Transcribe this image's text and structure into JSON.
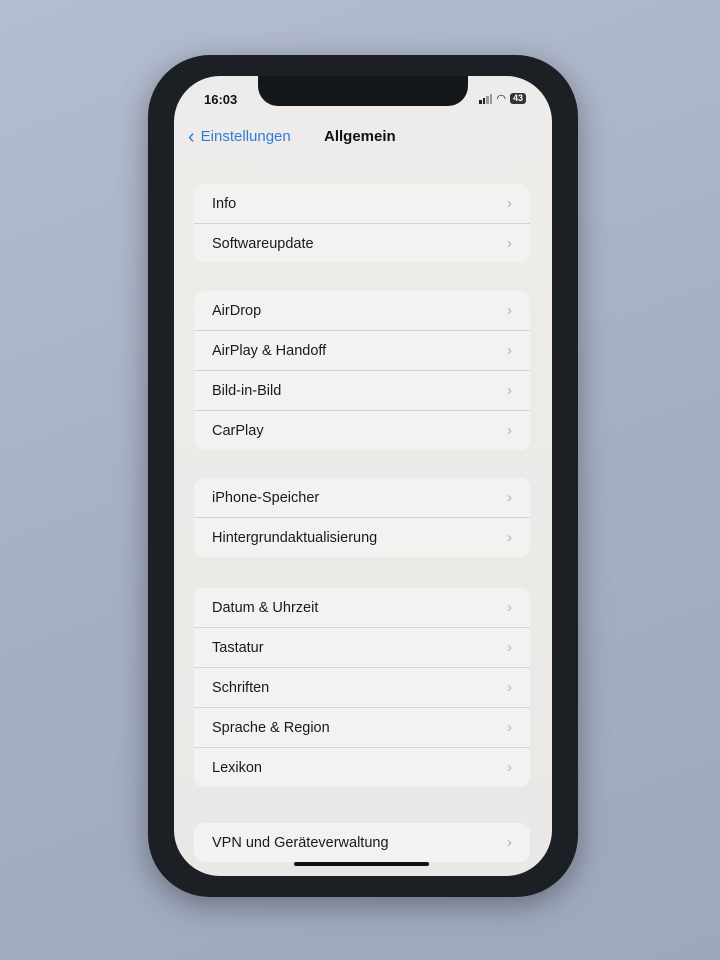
{
  "status": {
    "time": "16:03",
    "battery": "43"
  },
  "nav": {
    "back_label": "Einstellungen",
    "title": "Allgemein"
  },
  "groups": [
    {
      "items": [
        "Info",
        "Softwareupdate"
      ]
    },
    {
      "items": [
        "AirDrop",
        "AirPlay & Handoff",
        "Bild-in-Bild",
        "CarPlay"
      ]
    },
    {
      "items": [
        "iPhone-Speicher",
        "Hintergrundaktualisierung"
      ]
    },
    {
      "items": [
        "Datum & Uhrzeit",
        "Tastatur",
        "Schriften",
        "Sprache & Region",
        "Lexikon"
      ]
    },
    {
      "items": [
        "VPN und Geräteverwaltung"
      ]
    }
  ],
  "icons": {
    "chevron": "›",
    "back": "‹",
    "wifi": "wifi-icon"
  }
}
